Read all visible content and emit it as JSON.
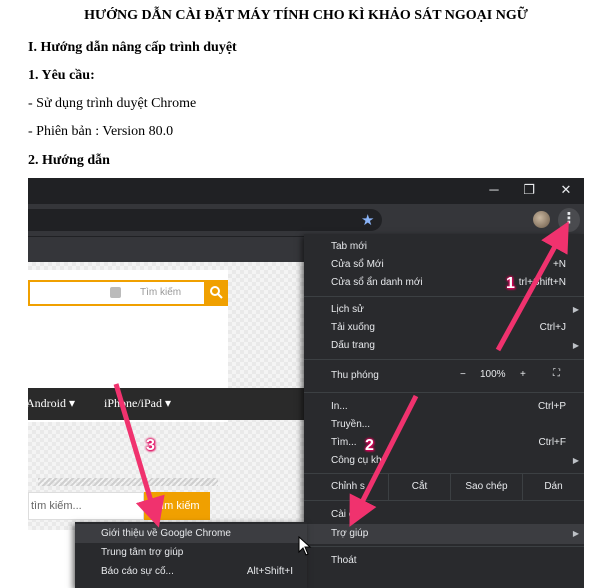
{
  "document": {
    "title": "HƯỚNG DẪN CÀI ĐẶT MÁY TÍNH CHO KÌ KHẢO SÁT NGOẠI NGỮ",
    "section_1": "I. Hướng dẫn nâng cấp trình duyệt",
    "sub_1": "1. Yêu cầu:",
    "req_browser": "- Sử dụng trình duyệt Chrome",
    "req_version": "- Phiên bản : Version 80.0",
    "sub_2": "2. Hướng dẫn"
  },
  "window_controls": {
    "minimize": "─",
    "restore": "❐",
    "close": "✕"
  },
  "toolbar": {
    "star_icon": "★",
    "menu_icon": "⋮"
  },
  "page": {
    "search_placeholder": "Tìm kiếm",
    "search_icon": "search-icon",
    "nav_android": "Android ▾",
    "nav_apple_icon": "",
    "nav_iphone": "iPhone/iPad ▾",
    "search2_placeholder": "tìm kiếm...",
    "search2_button": "Tìm kiếm"
  },
  "chrome_menu": {
    "new_tab": {
      "label": "Tab mới",
      "shortcut": "T"
    },
    "new_window": {
      "label": "Cửa sổ Mới",
      "shortcut": "+N"
    },
    "incognito": {
      "label": "Cửa sổ ẩn danh mới",
      "shortcut": "trl+Shift+N"
    },
    "history": {
      "label": "Lịch sử"
    },
    "downloads": {
      "label": "Tải xuống",
      "shortcut": "Ctrl+J"
    },
    "bookmarks": {
      "label": "Dấu trang"
    },
    "zoom": {
      "label": "Thu phóng",
      "minus": "−",
      "value": "100%",
      "plus": "+",
      "fullscreen_icon": "⛶"
    },
    "print": {
      "label": "In...",
      "shortcut": "Ctrl+P"
    },
    "cast": {
      "label": "Truyền..."
    },
    "find": {
      "label": "Tìm...",
      "shortcut": "Ctrl+F"
    },
    "more_tools": {
      "label": "Công cụ kh"
    },
    "edit": {
      "label": "Chỉnh s",
      "cut": "Cắt",
      "copy": "Sao chép",
      "paste": "Dán"
    },
    "settings": {
      "label": "Cài đ"
    },
    "help": {
      "label": "Trợ giúp"
    },
    "exit": {
      "label": "Thoát"
    }
  },
  "help_submenu": {
    "about": {
      "label": "Giới thiệu về Google Chrome"
    },
    "help_center": {
      "label": "Trung tâm trợ giúp"
    },
    "report": {
      "label": "Báo cáo sự cố...",
      "shortcut": "Alt+Shift+I"
    }
  },
  "annotations": {
    "step1": "1",
    "step2": "2",
    "step3": "3"
  },
  "colors": {
    "arrow": "#f0326e",
    "orange": "#f0a000",
    "menu_bg": "#292a2d"
  }
}
